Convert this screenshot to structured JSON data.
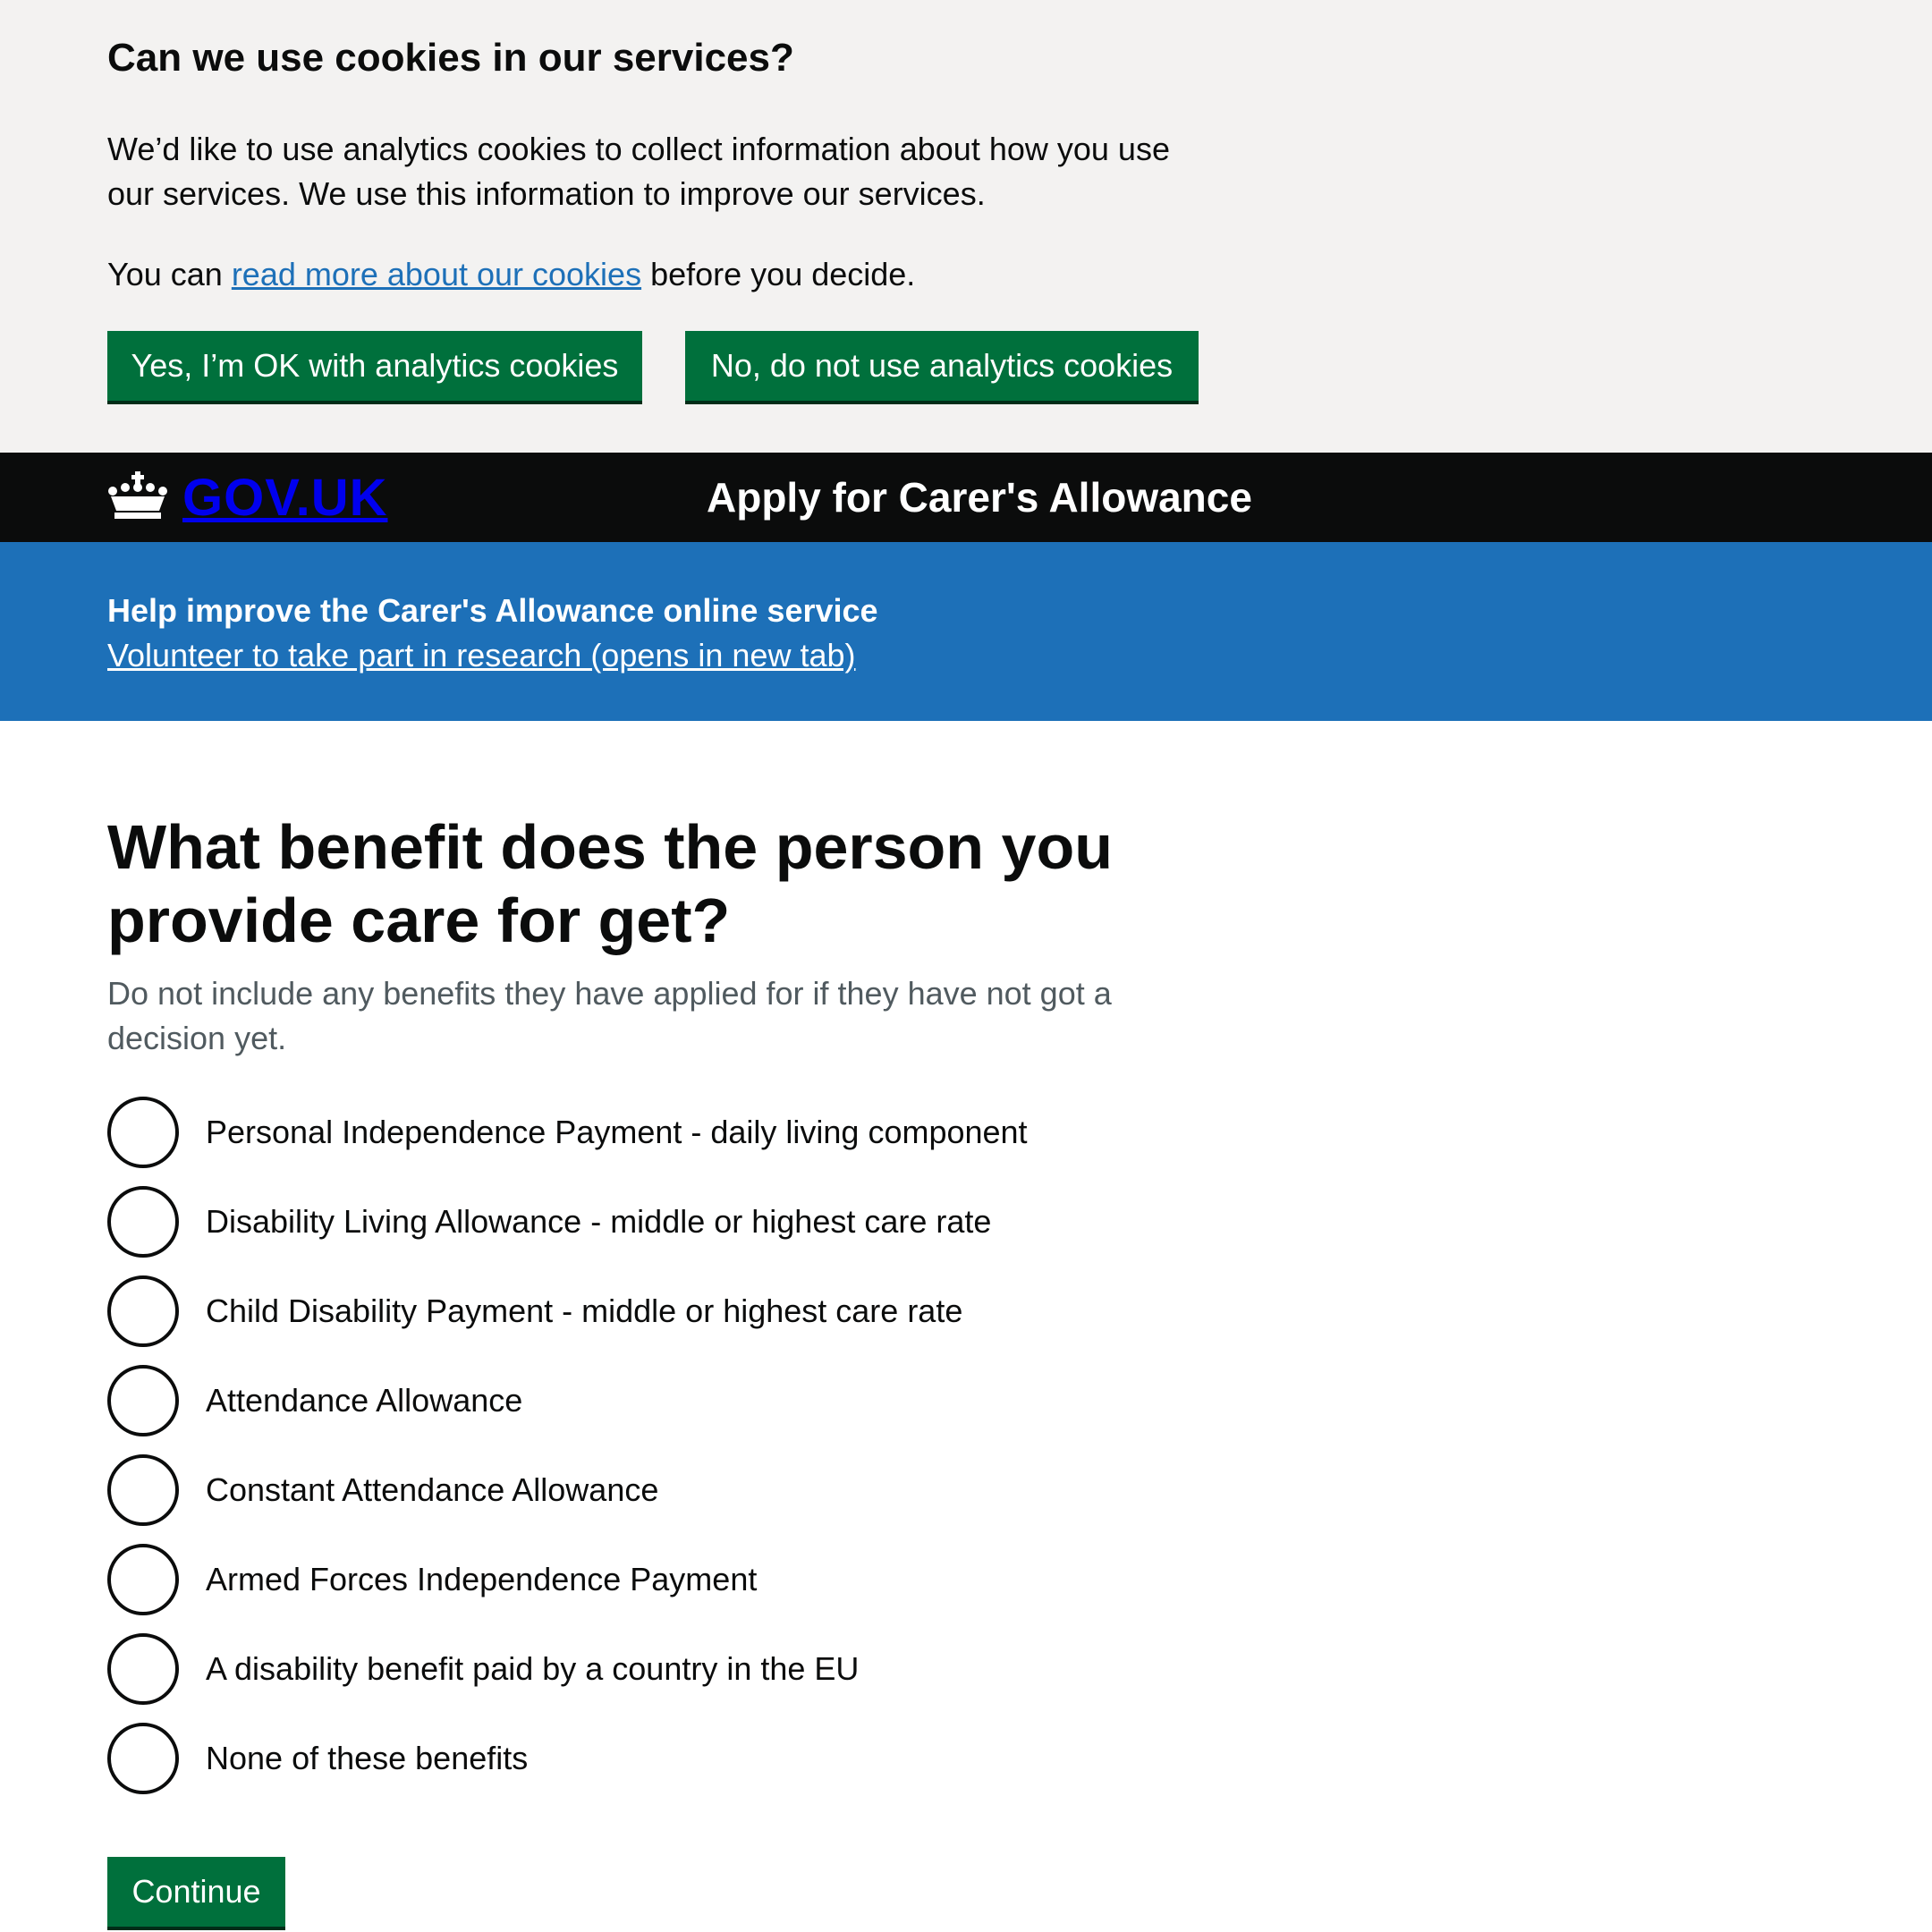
{
  "cookie_banner": {
    "title": "Can we use cookies in our services?",
    "text": "We’d like to use analytics cookies to collect information about how you use our services. We use this information to improve our services.",
    "more_prefix": "You can",
    "more_link": "read more about our cookies",
    "more_suffix": "before you decide.",
    "accept_label": "Yes, I’m OK with analytics cookies",
    "reject_label": "No, do not use analytics cookies"
  },
  "header": {
    "logo_text": "GOV.UK",
    "logo_icon": "crown-icon",
    "service_name": "Apply for Carer's Allowance"
  },
  "phase_banner": {
    "title": "Help improve the Carer's Allowance online service",
    "link": "Volunteer to take part in research (opens in new tab)"
  },
  "question": {
    "heading": "What benefit does the person you provide care for get?",
    "hint": "Do not include any benefits they have applied for if they have not got a decision yet.",
    "options": [
      "Personal Independence Payment - daily living component",
      "Disability Living Allowance - middle or highest care rate",
      "Child Disability Payment - middle or highest care rate",
      "Attendance Allowance",
      "Constant Attendance Allowance",
      "Armed Forces Independence Payment",
      "A disability benefit paid by a country in the EU",
      "None of these benefits"
    ]
  },
  "continue_label": "Continue",
  "colors": {
    "banner_bg": "#f3f2f1",
    "header_bg": "#0b0c0c",
    "phase_bg": "#1d70b8",
    "button_green": "#00703c",
    "link_blue": "#1d70b8",
    "hint_grey": "#505a5f"
  }
}
